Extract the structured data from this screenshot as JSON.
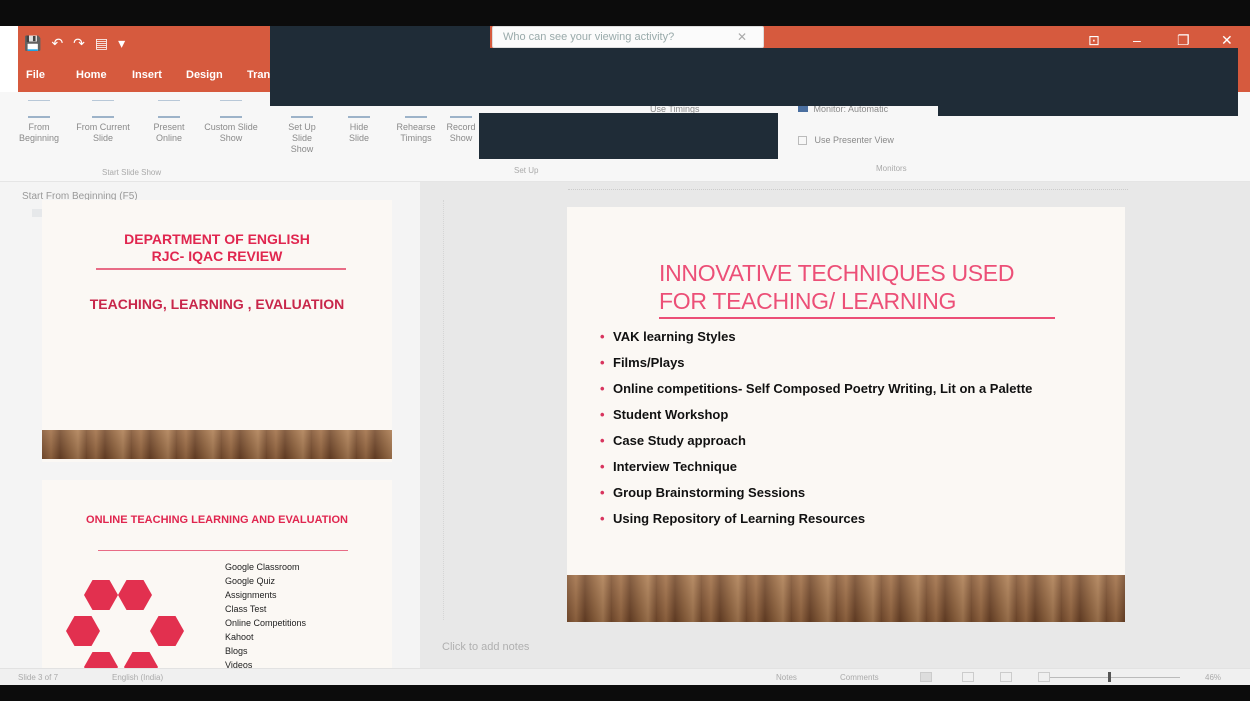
{
  "window": {
    "search_placeholder": "Who can see your viewing activity?",
    "search_close": "✕",
    "quick_access": [
      "💾",
      "↶",
      "↷",
      "▤",
      "▾"
    ],
    "controls": [
      "⊡",
      "–",
      "❐",
      "✕"
    ]
  },
  "tabs": [
    "File",
    "Home",
    "Insert",
    "Design",
    "Tran"
  ],
  "ribbon": {
    "start_group": {
      "buttons": [
        "From Beginning",
        "From Current Slide",
        "Present Online",
        "Custom Slide Show"
      ],
      "label": "Start Slide Show"
    },
    "setup_group": {
      "buttons": [
        "Set Up Slide Show",
        "Hide Slide",
        "Rehearse Timings",
        "Record Show"
      ],
      "label": "Set Up",
      "use_timings": "Use Timings"
    },
    "monitors_group": {
      "monitor_label": "Monitor:",
      "monitor_value": "Automatic",
      "presenter_view": "Use Presenter View",
      "label": "Monitors"
    }
  },
  "left_pane": {
    "tooltip_title": "Start From Beginning (F5)",
    "slide1": {
      "line1": "DEPARTMENT OF ENGLISH",
      "line2": "RJC- IQAC REVIEW",
      "subtitle": "TEACHING, LEARNING , EVALUATION"
    },
    "slide2": {
      "title": "ONLINE TEACHING LEARNING AND EVALUATION",
      "list": [
        "Google Classroom",
        "Google Quiz",
        "Assignments",
        "Class Test",
        "Online Competitions",
        "Kahoot",
        "Blogs",
        "Videos"
      ]
    }
  },
  "main_slide": {
    "title_line1": "INNOVATIVE TECHNIQUES  USED",
    "title_line2": "FOR TEACHING/ LEARNING",
    "bullets": [
      "VAK learning Styles",
      "Films/Plays",
      "Online competitions- Self Composed Poetry Writing, Lit on a Palette",
      "Student Workshop",
      "Case Study approach",
      "Interview Technique",
      "Group Brainstorming Sessions",
      "Using Repository of Learning Resources"
    ]
  },
  "notes_placeholder": "Click to add notes",
  "status": {
    "slide_count": "Slide 3 of 7",
    "language": "English (India)",
    "notes": "Notes",
    "comments": "Comments",
    "zoom": "46%"
  },
  "colors": {
    "titlebar": "#d65a3e",
    "slide_accent": "#ec4f77",
    "redaction": "#1f2c37"
  }
}
